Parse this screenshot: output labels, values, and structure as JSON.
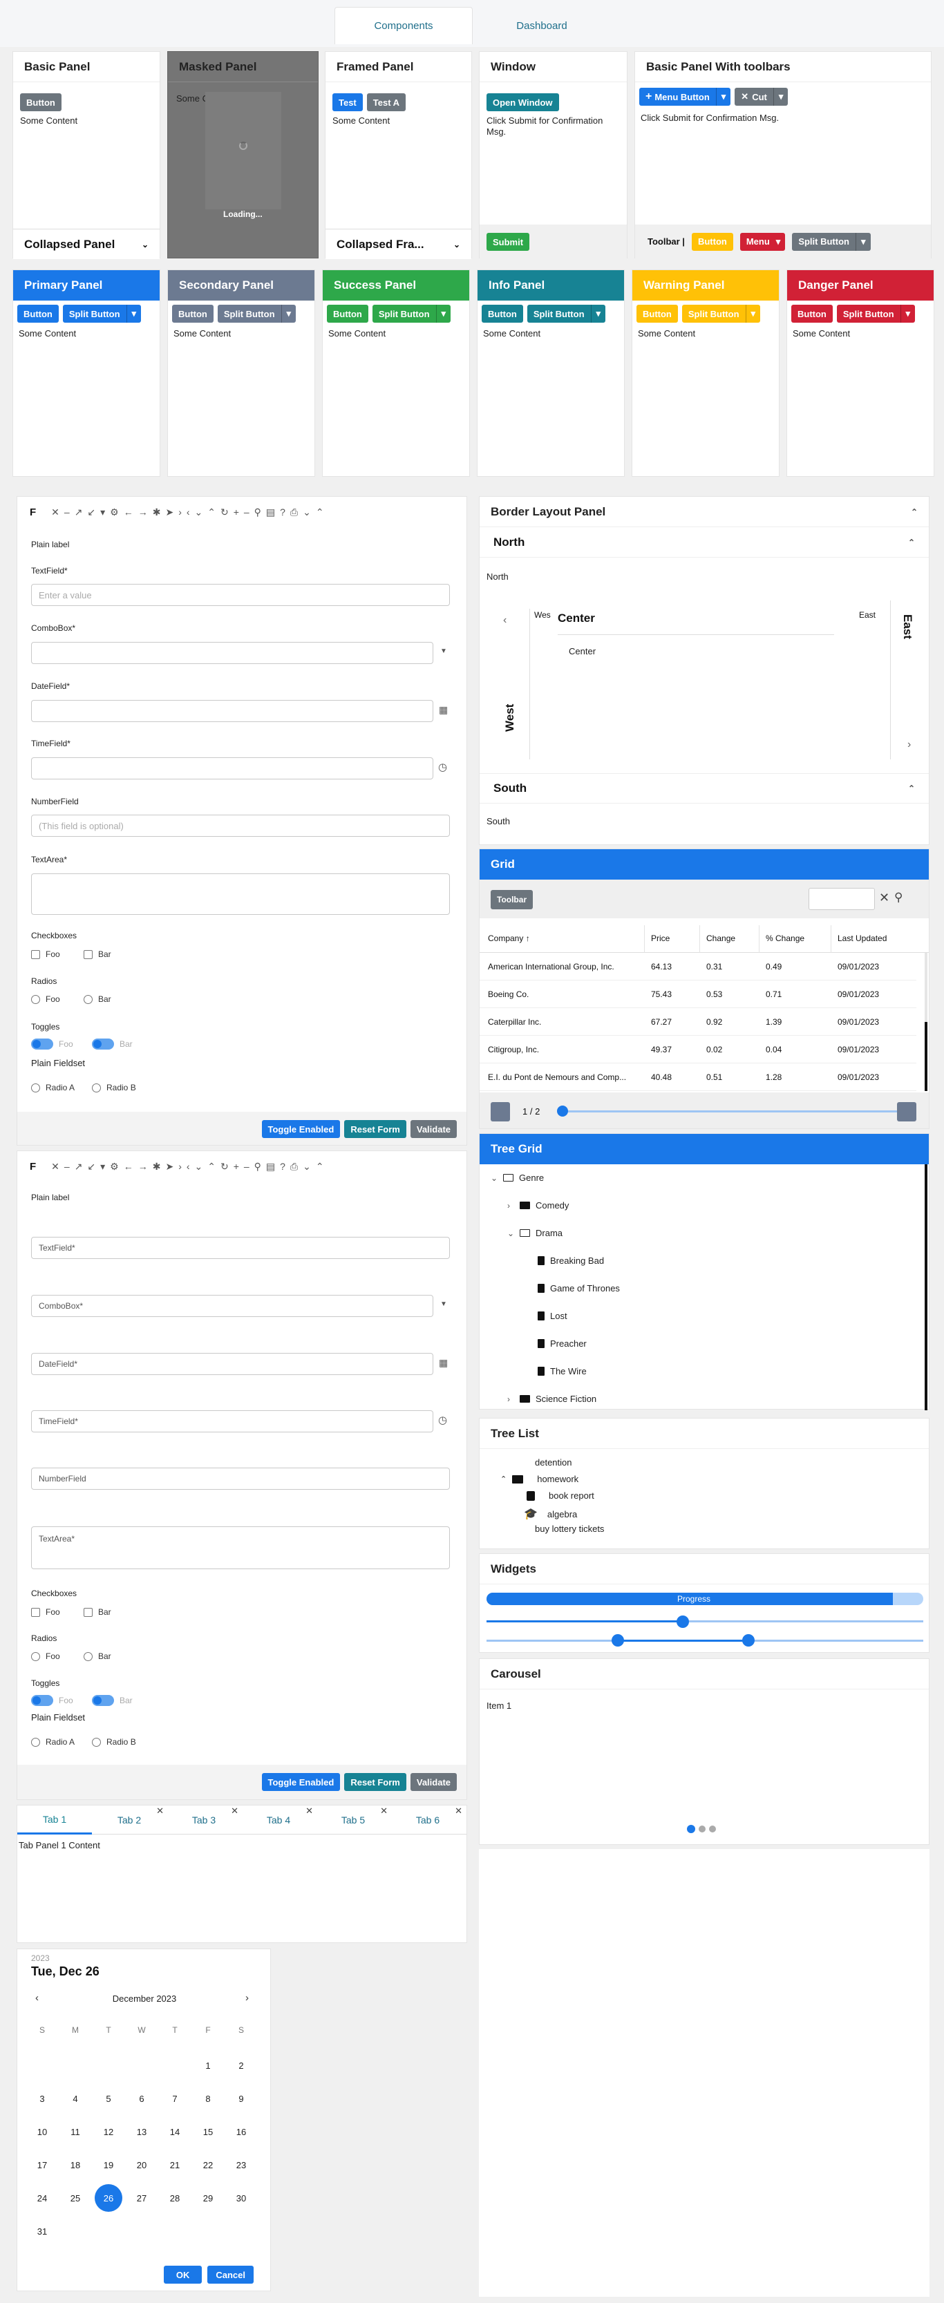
{
  "tabs": {
    "components": "Components",
    "dashboard": "Dashboard"
  },
  "row1": {
    "basic": {
      "title": "Basic Panel",
      "button": "Button",
      "content": "Some Content",
      "collapsed": "Collapsed Panel"
    },
    "masked": {
      "title": "Masked Panel",
      "content": "Some Content",
      "loading": "Loading..."
    },
    "framed": {
      "title": "Framed Panel",
      "btn1": "Test",
      "btn2": "Test A",
      "content": "Some Content",
      "collapsed": "Collapsed Fra..."
    },
    "window": {
      "title": "Window",
      "open": "Open Window",
      "msg": "Click Submit for Confirmation Msg.",
      "submit": "Submit"
    },
    "toolbars": {
      "title": "Basic Panel With toolbars",
      "menu_button": "Menu Button",
      "cut": "Cut",
      "msg": "Click Submit for Confirmation Msg.",
      "toolbar_label": "Toolbar |",
      "button": "Button",
      "menu": "Menu",
      "split": "Split Button"
    }
  },
  "row2": [
    {
      "title": "Primary Panel",
      "button": "Button",
      "split": "Split Button",
      "content": "Some Content",
      "color": "#1a78e8"
    },
    {
      "title": "Secondary Panel",
      "button": "Button",
      "split": "Split Button",
      "content": "Some Content",
      "color": "#6c7a91"
    },
    {
      "title": "Success Panel",
      "button": "Button",
      "split": "Split Button",
      "content": "Some Content",
      "color": "#2ea84a"
    },
    {
      "title": "Info Panel",
      "button": "Button",
      "split": "Split Button",
      "content": "Some Content",
      "color": "#178394"
    },
    {
      "title": "Warning Panel",
      "button": "Button",
      "split": "Split Button",
      "content": "Some Content",
      "color": "#ffc107"
    },
    {
      "title": "Danger Panel",
      "button": "Button",
      "split": "Split Button",
      "content": "Some Content",
      "color": "#d12136"
    }
  ],
  "form1": {
    "toolbar_title": "F",
    "plain_label": "Plain label",
    "textfield_label": "TextField*",
    "textfield_placeholder": "Enter a value",
    "combobox_label": "ComboBox*",
    "datefield_label": "DateField*",
    "timefield_label": "TimeField*",
    "numberfield_label": "NumberField",
    "number_placeholder": "(This field is optional)",
    "textarea_label": "TextArea*",
    "checkboxes": "Checkboxes",
    "foo": "Foo",
    "bar": "Bar",
    "radios": "Radios",
    "toggles": "Toggles",
    "fieldset": "Plain Fieldset",
    "radio_a": "Radio A",
    "radio_b": "Radio B",
    "toggle_enabled": "Toggle Enabled",
    "reset": "Reset Form",
    "validate": "Validate"
  },
  "form2": {
    "toolbar_title": "F",
    "plain_label": "Plain label",
    "textfield": "TextField*",
    "combobox": "ComboBox*",
    "datefield": "DateField*",
    "timefield": "TimeField*",
    "numberfield": "NumberField",
    "textarea": "TextArea*",
    "checkboxes": "Checkboxes",
    "foo": "Foo",
    "bar": "Bar",
    "radios": "Radios",
    "toggles": "Toggles",
    "fieldset": "Plain Fieldset",
    "radio_a": "Radio A",
    "radio_b": "Radio B",
    "toggle_enabled": "Toggle Enabled",
    "reset": "Reset Form",
    "validate": "Validate"
  },
  "tabpanel": {
    "tabs": [
      "Tab 1",
      "Tab 2",
      "Tab 3",
      "Tab 4",
      "Tab 5",
      "Tab 6"
    ],
    "content": "Tab Panel 1 Content"
  },
  "calendar": {
    "year": "2023",
    "date": "Tue, Dec 26",
    "month": "December 2023",
    "weekdays": [
      "S",
      "M",
      "T",
      "W",
      "T",
      "F",
      "S"
    ],
    "days": [
      "1",
      "2",
      "3",
      "4",
      "5",
      "6",
      "7",
      "8",
      "9",
      "10",
      "11",
      "12",
      "13",
      "14",
      "15",
      "16",
      "17",
      "18",
      "19",
      "20",
      "21",
      "22",
      "23",
      "24",
      "25",
      "26",
      "27",
      "28",
      "29",
      "30",
      "31"
    ],
    "selected": "26",
    "ok": "OK",
    "cancel": "Cancel"
  },
  "border": {
    "title": "Border Layout Panel",
    "north": "North",
    "north_content": "North",
    "west_short": "Wes",
    "center": "Center",
    "center_content": "Center",
    "east_short": "East",
    "east": "East",
    "west": "West",
    "south": "South",
    "south_content": "South"
  },
  "grid": {
    "title": "Grid",
    "toolbar": "Toolbar",
    "columns": [
      "Company",
      "Price",
      "Change",
      "% Change",
      "Last Updated"
    ],
    "rows": [
      [
        "American International Group, Inc.",
        "64.13",
        "0.31",
        "0.49",
        "09/01/2023"
      ],
      [
        "Boeing Co.",
        "75.43",
        "0.53",
        "0.71",
        "09/01/2023"
      ],
      [
        "Caterpillar Inc.",
        "67.27",
        "0.92",
        "1.39",
        "09/01/2023"
      ],
      [
        "Citigroup, Inc.",
        "49.37",
        "0.02",
        "0.04",
        "09/01/2023"
      ],
      [
        "E.I. du Pont de Nemours and Comp...",
        "40.48",
        "0.51",
        "1.28",
        "09/01/2023"
      ]
    ],
    "pager": "1 / 2"
  },
  "treegrid": {
    "title": "Tree Grid",
    "nodes": [
      "Genre",
      "Comedy",
      "Drama",
      "Breaking Bad",
      "Game of Thrones",
      "Lost",
      "Preacher",
      "The Wire",
      "Science Fiction"
    ]
  },
  "treelist": {
    "title": "Tree List",
    "items": [
      "detention",
      "homework",
      "book report",
      "algebra",
      "buy lottery tickets"
    ]
  },
  "widgets": {
    "title": "Widgets",
    "progress_label": "Progress",
    "progress": 0.93,
    "slider": 0.45,
    "range": [
      0.3,
      0.6
    ]
  },
  "carousel": {
    "title": "Carousel",
    "item": "Item 1"
  },
  "colors": {
    "accent": "#1a78e8",
    "teal": "#178394"
  }
}
